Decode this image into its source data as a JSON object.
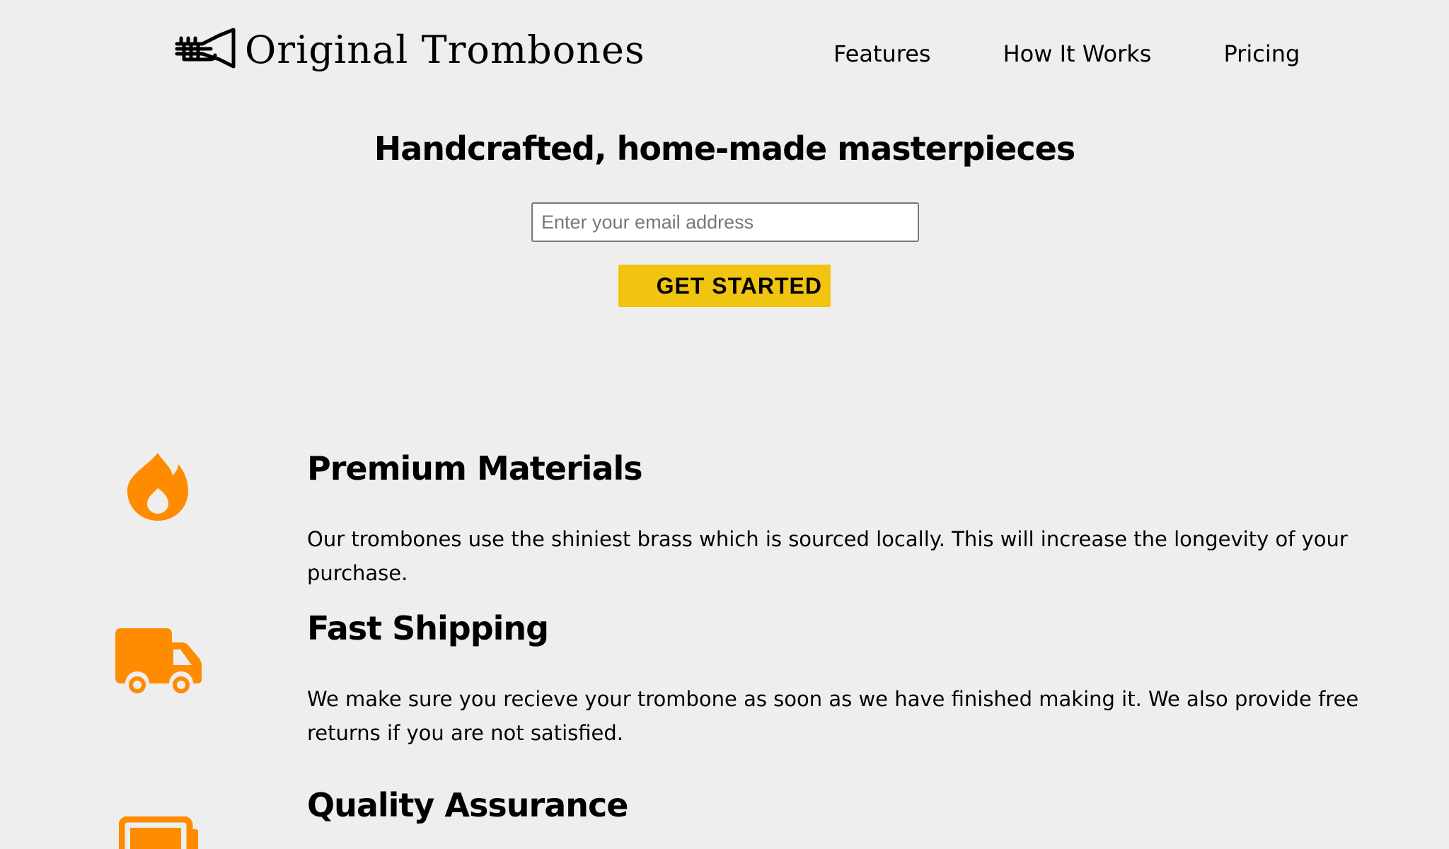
{
  "header": {
    "brand": "Original Trombones",
    "logo_icon": "trombone-icon",
    "nav": [
      {
        "label": "Features"
      },
      {
        "label": "How It Works"
      },
      {
        "label": "Pricing"
      }
    ]
  },
  "hero": {
    "title": "Handcrafted, home-made masterpieces",
    "email_placeholder": "Enter your email address",
    "cta_label": "GET STARTED",
    "cta_color": "#f1c40f"
  },
  "features": [
    {
      "icon": "fire-icon",
      "title": "Premium Materials",
      "description": "Our trombones use the shiniest brass which is sourced locally. This will increase the longevity of your purchase."
    },
    {
      "icon": "truck-icon",
      "title": "Fast Shipping",
      "description": "We make sure you recieve your trombone as soon as we have finished making it. We also provide free returns if you are not satisfied."
    },
    {
      "icon": "battery-icon",
      "title": "Quality Assurance",
      "description": ""
    }
  ],
  "colors": {
    "background": "#eeeeee",
    "accent_icon": "#ff8c00"
  }
}
